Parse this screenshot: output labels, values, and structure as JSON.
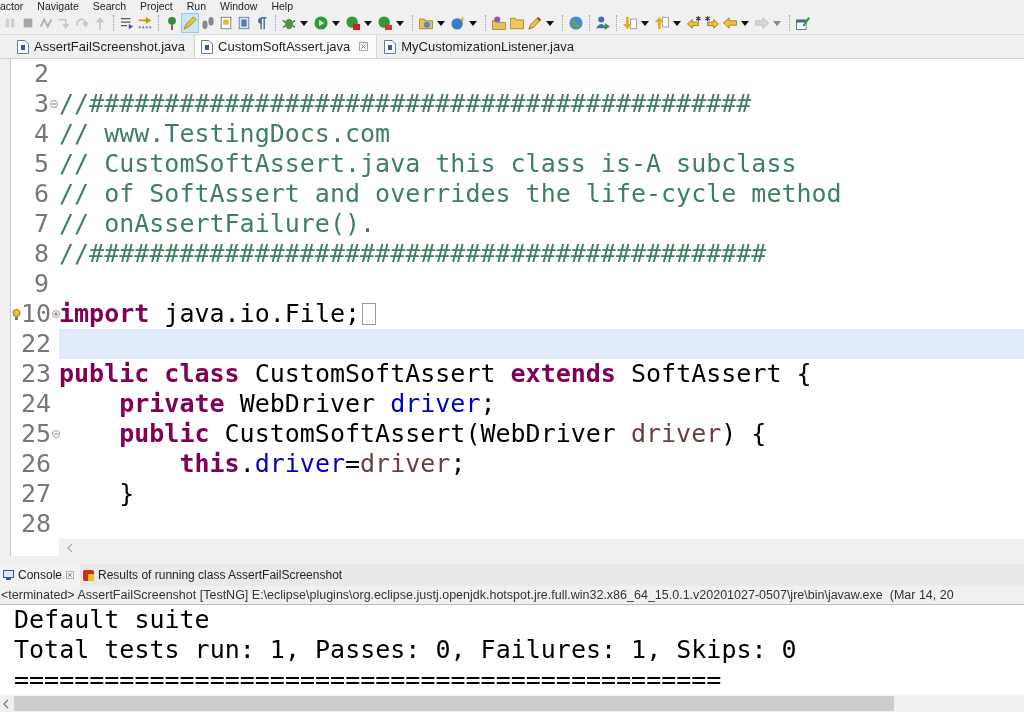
{
  "menu": [
    "actor",
    "Navigate",
    "Search",
    "Project",
    "Run",
    "Window",
    "Help"
  ],
  "toolbar": {
    "items": [
      {
        "kind": "button",
        "disabled": true,
        "selected": false
      },
      {
        "kind": "button",
        "disabled": true,
        "selected": false
      },
      {
        "kind": "button",
        "disabled": true,
        "selected": false
      },
      {
        "kind": "button",
        "disabled": true,
        "selected": false
      },
      {
        "kind": "button",
        "disabled": true,
        "selected": false
      },
      {
        "kind": "button",
        "disabled": true,
        "selected": false
      },
      {
        "kind": "separator"
      },
      {
        "kind": "button",
        "disabled": false,
        "selected": false
      },
      {
        "kind": "button",
        "disabled": false,
        "selected": false
      },
      {
        "kind": "separator"
      },
      {
        "kind": "button",
        "disabled": false,
        "selected": false
      },
      {
        "kind": "button",
        "disabled": false,
        "selected": true
      },
      {
        "kind": "button",
        "disabled": false,
        "selected": false
      },
      {
        "kind": "button",
        "disabled": false,
        "selected": false
      },
      {
        "kind": "button",
        "disabled": false,
        "selected": false
      },
      {
        "kind": "button",
        "disabled": false,
        "selected": false
      },
      {
        "kind": "separator"
      },
      {
        "kind": "button",
        "disabled": false,
        "selected": false
      },
      {
        "kind": "dropdown",
        "disabled": false
      },
      {
        "kind": "button",
        "disabled": false,
        "selected": false
      },
      {
        "kind": "dropdown",
        "disabled": false
      },
      {
        "kind": "button",
        "disabled": false,
        "selected": false
      },
      {
        "kind": "dropdown",
        "disabled": false
      },
      {
        "kind": "button",
        "disabled": false,
        "selected": false
      },
      {
        "kind": "dropdown",
        "disabled": false
      },
      {
        "kind": "separator"
      },
      {
        "kind": "button",
        "disabled": false,
        "selected": false
      },
      {
        "kind": "dropdown",
        "disabled": false
      },
      {
        "kind": "button",
        "disabled": false,
        "selected": false
      },
      {
        "kind": "dropdown",
        "disabled": false
      },
      {
        "kind": "separator"
      },
      {
        "kind": "button",
        "disabled": false,
        "selected": false
      },
      {
        "kind": "button",
        "disabled": false,
        "selected": false
      },
      {
        "kind": "button",
        "disabled": false,
        "selected": false
      },
      {
        "kind": "dropdown",
        "disabled": false
      },
      {
        "kind": "separator"
      },
      {
        "kind": "button",
        "disabled": false,
        "selected": false
      },
      {
        "kind": "separator"
      },
      {
        "kind": "button",
        "disabled": false,
        "selected": false
      },
      {
        "kind": "separator"
      },
      {
        "kind": "button",
        "disabled": false,
        "selected": false
      },
      {
        "kind": "dropdown",
        "disabled": false
      },
      {
        "kind": "button",
        "disabled": false,
        "selected": false
      },
      {
        "kind": "dropdown",
        "disabled": false
      },
      {
        "kind": "button",
        "disabled": false,
        "selected": false
      },
      {
        "kind": "button",
        "disabled": false,
        "selected": false
      },
      {
        "kind": "button",
        "disabled": false,
        "selected": false
      },
      {
        "kind": "dropdown",
        "disabled": false
      },
      {
        "kind": "button",
        "disabled": true,
        "selected": false
      },
      {
        "kind": "dropdown",
        "disabled": true
      },
      {
        "kind": "separator"
      },
      {
        "kind": "button",
        "disabled": false,
        "selected": false
      }
    ]
  },
  "editor": {
    "tabs": [
      {
        "label": "AssertFailScreenshot.java",
        "selected": false
      },
      {
        "label": "CustomSoftAssert.java",
        "selected": true
      },
      {
        "label": "MyCustomizationListener.java",
        "selected": false
      }
    ],
    "lines": [
      {
        "number": "2",
        "current": false,
        "warning": false
      },
      {
        "number": "3",
        "current": false,
        "warning": false,
        "expanded": true,
        "tokens": [
          {
            "text": "//############################################",
            "kind": "comment"
          }
        ]
      },
      {
        "number": "4",
        "current": false,
        "warning": false,
        "tokens": [
          {
            "text": "// www.TestingDocs.com",
            "kind": "comment"
          }
        ]
      },
      {
        "number": "5",
        "current": false,
        "warning": false,
        "tokens": [
          {
            "text": "// CustomSoftAssert.java this class is-A subclass",
            "kind": "comment"
          }
        ]
      },
      {
        "number": "6",
        "current": false,
        "warning": false,
        "tokens": [
          {
            "text": "// of SoftAssert and overrides the life-cycle method",
            "kind": "comment"
          }
        ]
      },
      {
        "number": "7",
        "current": false,
        "warning": false,
        "tokens": [
          {
            "text": "// onAssertFailure().",
            "kind": "comment"
          }
        ]
      },
      {
        "number": "8",
        "current": false,
        "warning": false,
        "tokens": [
          {
            "text": "//#############################################",
            "kind": "comment"
          }
        ]
      },
      {
        "number": "9",
        "current": false,
        "warning": false
      },
      {
        "number": "10",
        "current": false,
        "warning": true,
        "expanded": false,
        "tokens": [
          {
            "text": "import",
            "kind": "keyword"
          },
          {
            "text": " java.io.File;",
            "kind": "plain"
          }
        ]
      },
      {
        "number": "22",
        "current": true,
        "warning": false
      },
      {
        "number": "23",
        "current": false,
        "warning": false,
        "tokens": [
          {
            "text": "public",
            "kind": "keyword"
          },
          {
            "text": " class",
            "kind": "keyword"
          },
          {
            "text": " CustomSoftAssert ",
            "kind": "plain"
          },
          {
            "text": "extends",
            "kind": "keyword"
          },
          {
            "text": " SoftAssert {",
            "kind": "plain"
          }
        ]
      },
      {
        "number": "24",
        "current": false,
        "warning": false,
        "tokens": [
          {
            "text": "    private",
            "kind": "keyword"
          },
          {
            "text": " WebDriver ",
            "kind": "plain"
          },
          {
            "text": "driver",
            "kind": "field"
          },
          {
            "text": ";",
            "kind": "plain"
          }
        ]
      },
      {
        "number": "25",
        "current": false,
        "warning": false,
        "expanded": true,
        "tokens": [
          {
            "text": "    public",
            "kind": "keyword"
          },
          {
            "text": " CustomSoftAssert(WebDriver ",
            "kind": "plain"
          },
          {
            "text": "driver",
            "kind": "param"
          },
          {
            "text": ") {",
            "kind": "plain"
          }
        ]
      },
      {
        "number": "26",
        "current": false,
        "warning": false,
        "tokens": [
          {
            "text": "        this",
            "kind": "keyword"
          },
          {
            "text": ".",
            "kind": "plain"
          },
          {
            "text": "driver",
            "kind": "field"
          },
          {
            "text": "=",
            "kind": "plain"
          },
          {
            "text": "driver",
            "kind": "param"
          },
          {
            "text": ";",
            "kind": "plain"
          }
        ]
      },
      {
        "number": "27",
        "current": false,
        "warning": false,
        "tokens": [
          {
            "text": "    }",
            "kind": "plain"
          }
        ]
      },
      {
        "number": "28",
        "current": false,
        "warning": false
      }
    ]
  },
  "console": {
    "tabs": [
      {
        "label": "Console",
        "kind": "console",
        "selected": true
      },
      {
        "label": "Results of running class AssertFailScreenshot",
        "kind": "results",
        "selected": false
      }
    ],
    "status": "<terminated> AssertFailScreenshot [TestNG] E:\\eclipse\\plugins\\org.eclipse.justj.openjdk.hotspot.jre.full.win32.x86_64_15.0.1.v20201027-0507\\jre\\bin\\javaw.exe  (Mar 14, 20",
    "output": [
      "Default suite",
      "Total tests run: 1, Passes: 0, Failures: 1, Skips: 0",
      "==============================================="
    ]
  }
}
